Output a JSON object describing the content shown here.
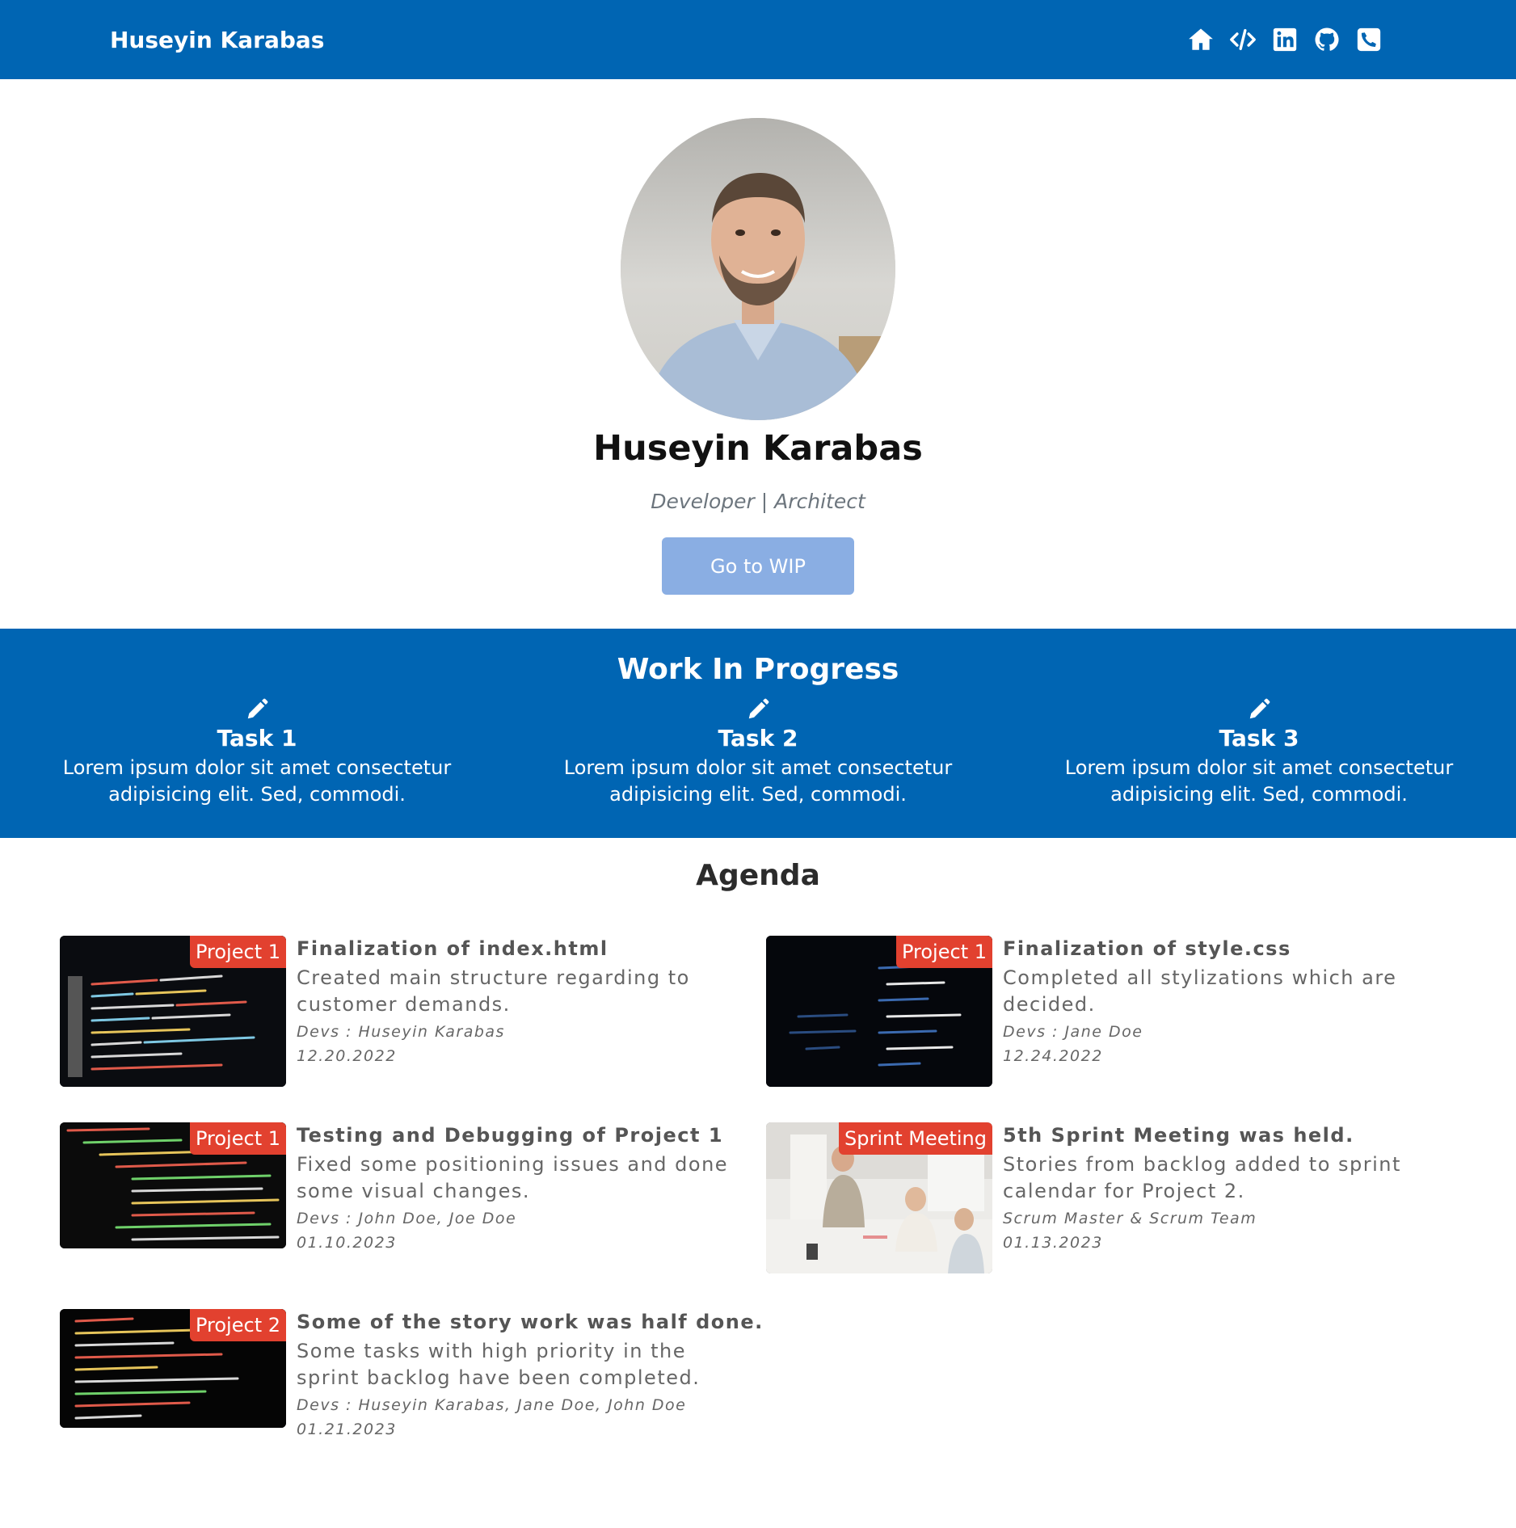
{
  "navbar": {
    "brand": "Huseyin Karabas",
    "icons": [
      "home-icon",
      "code-icon",
      "linkedin-icon",
      "github-icon",
      "phone-icon"
    ]
  },
  "hero": {
    "name": "Huseyin Karabas",
    "role": "Developer | Architect",
    "button_label": "Go to WIP"
  },
  "wip": {
    "title": "Work In Progress",
    "tasks": [
      {
        "title": "Task 1",
        "text": "Lorem ipsum dolor sit amet consectetur adipisicing elit. Sed, commodi."
      },
      {
        "title": "Task 2",
        "text": "Lorem ipsum dolor sit amet consectetur adipisicing elit. Sed, commodi."
      },
      {
        "title": "Task 3",
        "text": "Lorem ipsum dolor sit amet consectetur adipisicing elit. Sed, commodi."
      }
    ]
  },
  "agenda": {
    "title": "Agenda",
    "items": [
      {
        "badge": "Project 1",
        "title": "Finalization of index.html",
        "desc": "Created main structure regarding to customer demands.",
        "devs": "Devs : Huseyin Karabas",
        "date": "12.20.2022"
      },
      {
        "badge": "Project 1",
        "title": "Finalization of style.css",
        "desc": "Completed all stylizations which are decided.",
        "devs": "Devs : Jane Doe",
        "date": "12.24.2022"
      },
      {
        "badge": "Project 1",
        "title": "Testing and Debugging of Project 1",
        "desc": "Fixed some positioning issues and done some visual changes.",
        "devs": "Devs : John Doe, Joe Doe",
        "date": "01.10.2023"
      },
      {
        "badge": "Sprint Meeting",
        "title": "5th Sprint Meeting was held.",
        "desc": "Stories from backlog added to sprint calendar for Project 2.",
        "devs": "Scrum Master & Scrum Team",
        "date": "01.13.2023"
      },
      {
        "badge": "Project 2",
        "title": "Some of the story work was half done.",
        "desc": "Some tasks with high priority in the sprint backlog have been completed.",
        "devs": "Devs : Huseyin Karabas, Jane Doe, John Doe",
        "date": "01.21.2023"
      }
    ]
  },
  "colors": {
    "primary": "#0065b3",
    "badge": "#e2412f",
    "button": "#8aaee3"
  }
}
